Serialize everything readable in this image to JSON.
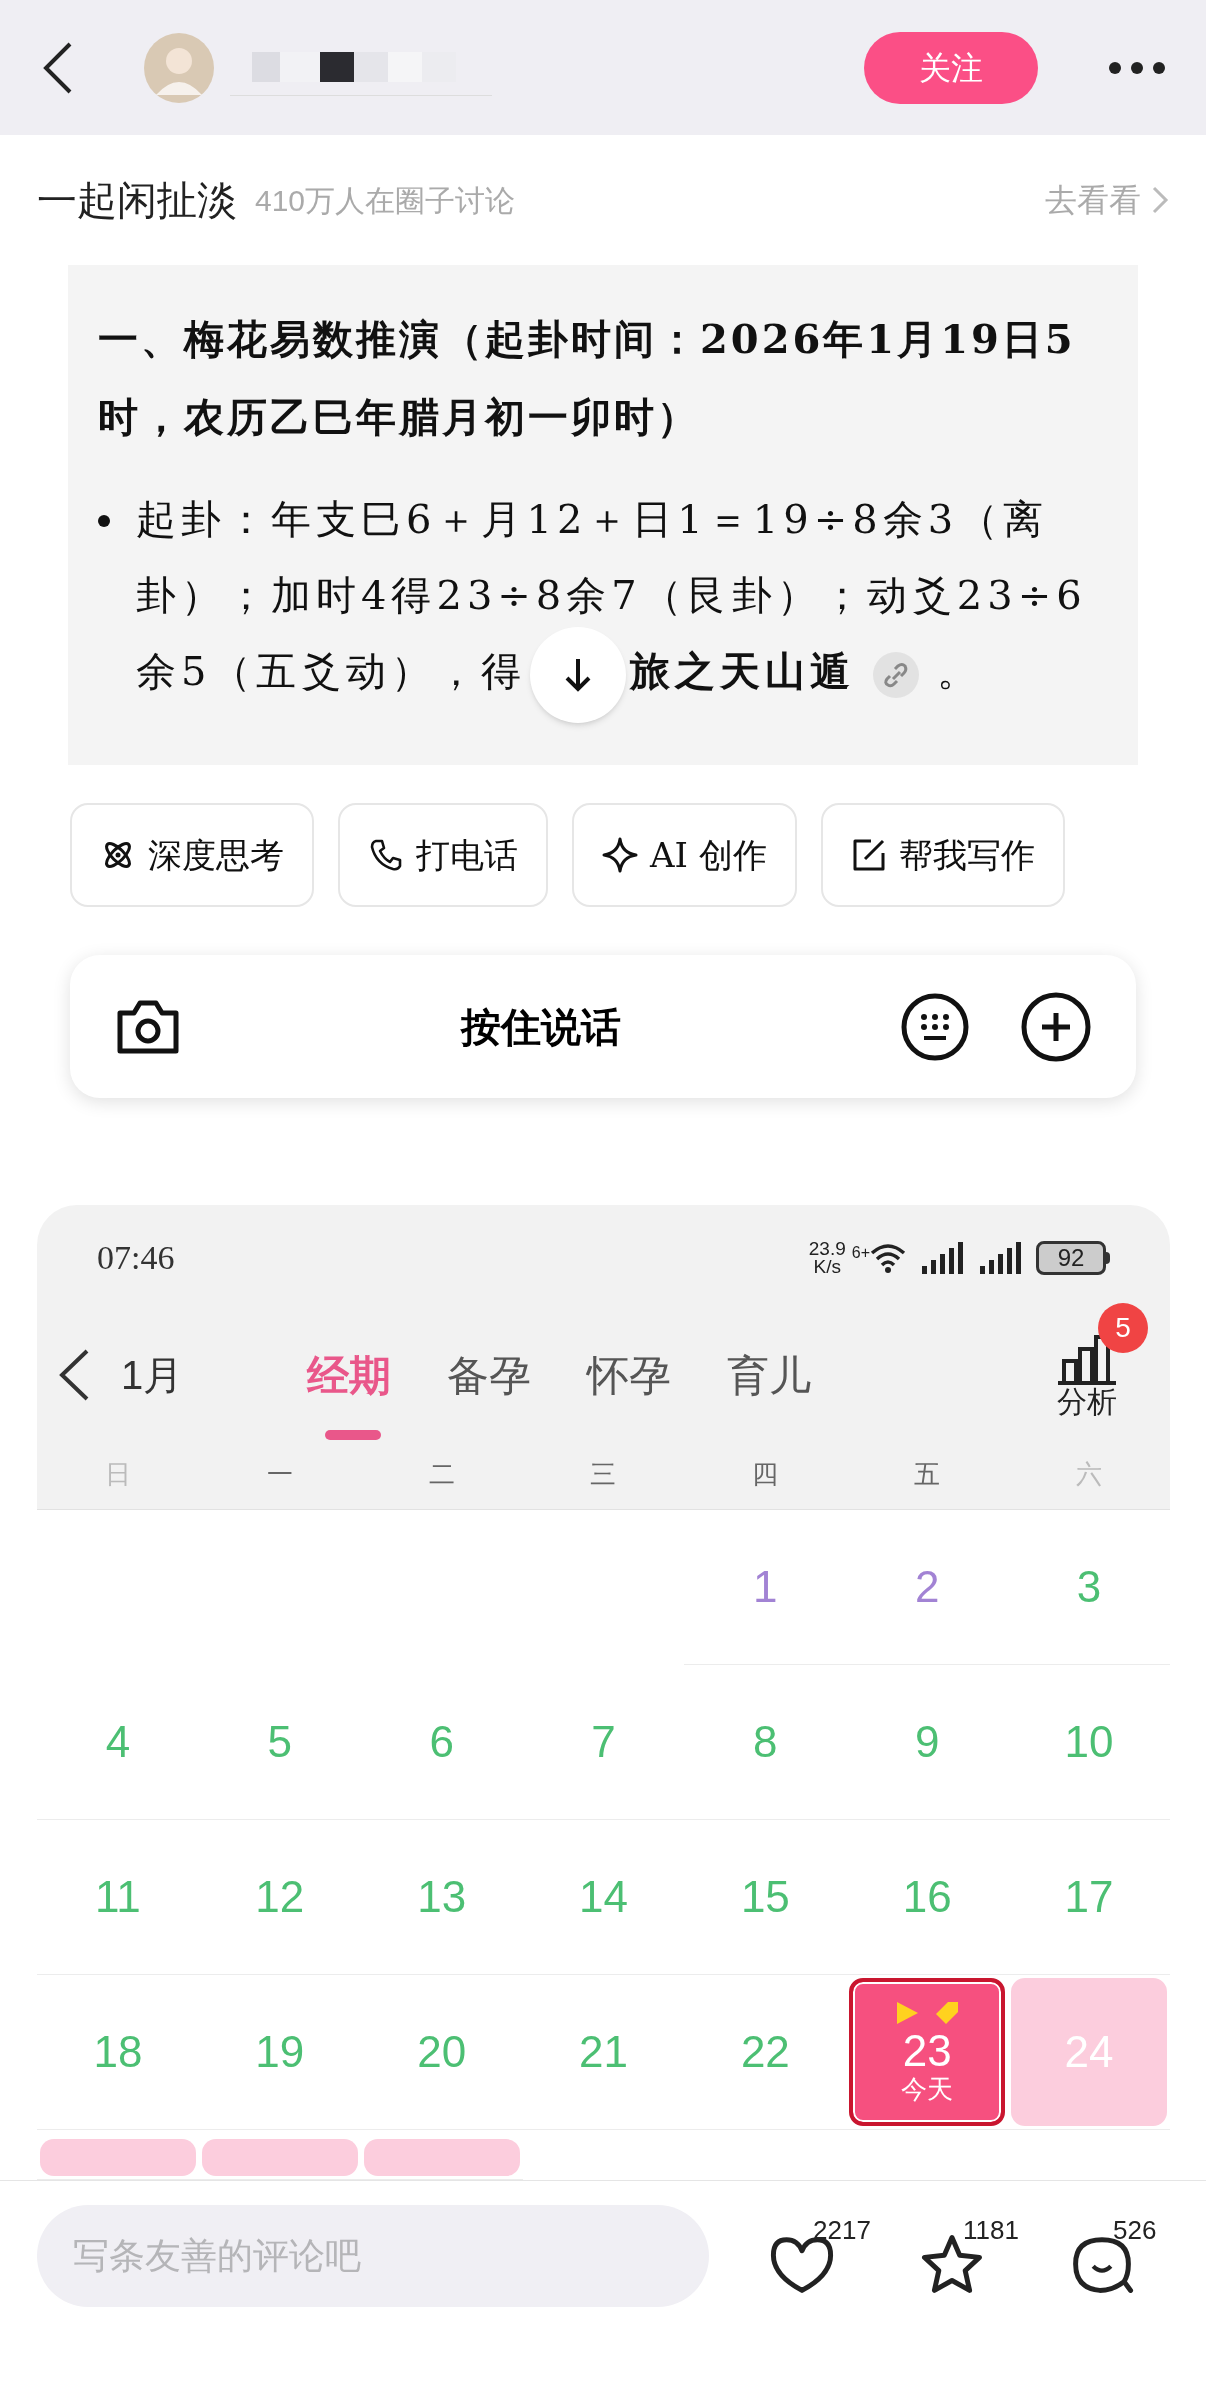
{
  "header": {
    "follow_button": "关注"
  },
  "circle": {
    "name": "一起闲扯淡",
    "members": "410万人在圈子讨论",
    "link": "去看看"
  },
  "answer": {
    "heading": "一、梅花易数推演（起卦时间：2026年1月19日5时，农历乙巳年腊月初一卯时）",
    "bullets": [
      {
        "text": "起卦：年支巳6＋月12＋日1＝19÷8余3（离卦）；加时4得23÷8余7（艮卦）；动爻23÷6余5（五爻动），得",
        "text_after": "**旅之天山遁**",
        "suffix": "。"
      }
    ]
  },
  "chips": [
    {
      "label": "深度思考",
      "kind": "atom"
    },
    {
      "label": "打电话",
      "kind": "phone"
    },
    {
      "label": "AI 创作",
      "kind": "sparkle"
    },
    {
      "label": "帮我写作",
      "kind": "edit"
    }
  ],
  "voice_bar": {
    "label": "按住说话"
  },
  "calendar_screenshot": {
    "status_bar": {
      "time": "07:46",
      "speed": "23.9",
      "speed_unit": "K/s",
      "wifi_label": "6+",
      "battery": "92"
    },
    "month": "1月",
    "tabs": [
      {
        "label": "经期",
        "selected": true
      },
      {
        "label": "备孕",
        "selected": false
      },
      {
        "label": "怀孕",
        "selected": false
      },
      {
        "label": "育儿",
        "selected": false
      }
    ],
    "analysis": {
      "label": "分析",
      "badge": "5"
    },
    "weekdays": [
      {
        "label": "日",
        "weekend": true
      },
      {
        "label": "一",
        "weekend": false
      },
      {
        "label": "二",
        "weekend": false
      },
      {
        "label": "三",
        "weekend": false
      },
      {
        "label": "四",
        "weekend": false
      },
      {
        "label": "五",
        "weekend": false
      },
      {
        "label": "六",
        "weekend": true
      }
    ],
    "weeks": [
      [
        {
          "kind": "empty"
        },
        {
          "kind": "empty"
        },
        {
          "kind": "empty"
        },
        {
          "kind": "empty"
        },
        {
          "kind": "day",
          "label": "1",
          "color": "#a283d4"
        },
        {
          "kind": "day",
          "label": "2",
          "color": "#a283d4"
        },
        {
          "kind": "day",
          "label": "3",
          "color": "#4cbf73"
        }
      ],
      [
        {
          "kind": "day",
          "label": "4",
          "color": "#4cbf73"
        },
        {
          "kind": "day",
          "label": "5",
          "color": "#4cbf73"
        },
        {
          "kind": "day",
          "label": "6",
          "color": "#4cbf73"
        },
        {
          "kind": "day",
          "label": "7",
          "color": "#4cbf73"
        },
        {
          "kind": "day",
          "label": "8",
          "color": "#4cbf73"
        },
        {
          "kind": "day",
          "label": "9",
          "color": "#4cbf73"
        },
        {
          "kind": "day",
          "label": "10",
          "color": "#4cbf73"
        }
      ],
      [
        {
          "kind": "day",
          "label": "11",
          "color": "#4cbf73"
        },
        {
          "kind": "day",
          "label": "12",
          "color": "#4cbf73"
        },
        {
          "kind": "day",
          "label": "13",
          "color": "#4cbf73"
        },
        {
          "kind": "day",
          "label": "14",
          "color": "#4cbf73"
        },
        {
          "kind": "day",
          "label": "15",
          "color": "#4cbf73"
        },
        {
          "kind": "day",
          "label": "16",
          "color": "#4cbf73"
        },
        {
          "kind": "day",
          "label": "17",
          "color": "#4cbf73"
        }
      ],
      [
        {
          "kind": "day",
          "label": "18",
          "color": "#4cbf73"
        },
        {
          "kind": "day",
          "label": "19",
          "color": "#4cbf73"
        },
        {
          "kind": "day",
          "label": "20",
          "color": "#4cbf73"
        },
        {
          "kind": "day",
          "label": "21",
          "color": "#4cbf73"
        },
        {
          "kind": "day",
          "label": "22",
          "color": "#4cbf73"
        },
        {
          "kind": "today",
          "label": "23",
          "sublabel": "今天"
        },
        {
          "kind": "period",
          "label": "24"
        }
      ],
      [
        {
          "kind": "period"
        },
        {
          "kind": "period"
        },
        {
          "kind": "period"
        },
        {
          "kind": "empty"
        },
        {
          "kind": "empty"
        },
        {
          "kind": "empty"
        },
        {
          "kind": "empty"
        }
      ]
    ]
  },
  "bottom_bar": {
    "comment_placeholder": "写条友善的评论吧",
    "actions": [
      {
        "kind": "like",
        "count": "2217"
      },
      {
        "kind": "favorite",
        "count": "1181"
      },
      {
        "kind": "comment",
        "count": "526"
      }
    ]
  }
}
